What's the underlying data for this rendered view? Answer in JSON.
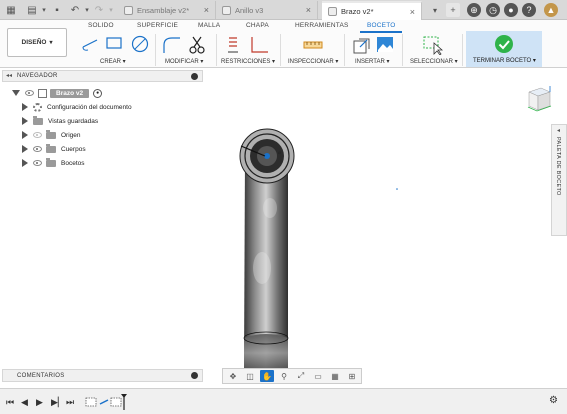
{
  "tabs": [
    {
      "label": "Ensamblaje v2*",
      "active": false
    },
    {
      "label": "Anillo v3",
      "active": false
    },
    {
      "label": "Brazo v2*",
      "active": true
    }
  ],
  "ribbon": {
    "tabs": [
      "SOLIDO",
      "SUPERFICIE",
      "MALLA",
      "CHAPA",
      "HERRAMIENTAS",
      "BOCETO"
    ],
    "active_tab": "BOCETO",
    "design_button": "DISEÑO",
    "groups": {
      "create": "CREAR",
      "modify": "MODIFICAR",
      "constraints": "RESTRICCIONES",
      "inspect": "INSPECCIONAR",
      "insert": "INSERTAR",
      "select": "SELECCIONAR",
      "finish": "TERMINAR BOCETO"
    }
  },
  "navigator": {
    "title": "NAVEGADOR",
    "root": "Brazo v2",
    "items": [
      {
        "label": "Configuración del documento",
        "icon": "gear-icon"
      },
      {
        "label": "Vistas guardadas",
        "icon": "folder-icon"
      },
      {
        "label": "Origen",
        "icon": "folder-icon"
      },
      {
        "label": "Cuerpos",
        "icon": "folder-icon"
      },
      {
        "label": "Bocetos",
        "icon": "folder-icon"
      }
    ]
  },
  "comments": {
    "title": "COMENTARIOS"
  },
  "palette": {
    "label": "PALETA DE BOCETO"
  },
  "colors": {
    "accent": "#1b72c9",
    "finish_green": "#2fb34a",
    "ribbon_bg": "#fbfbfb"
  }
}
